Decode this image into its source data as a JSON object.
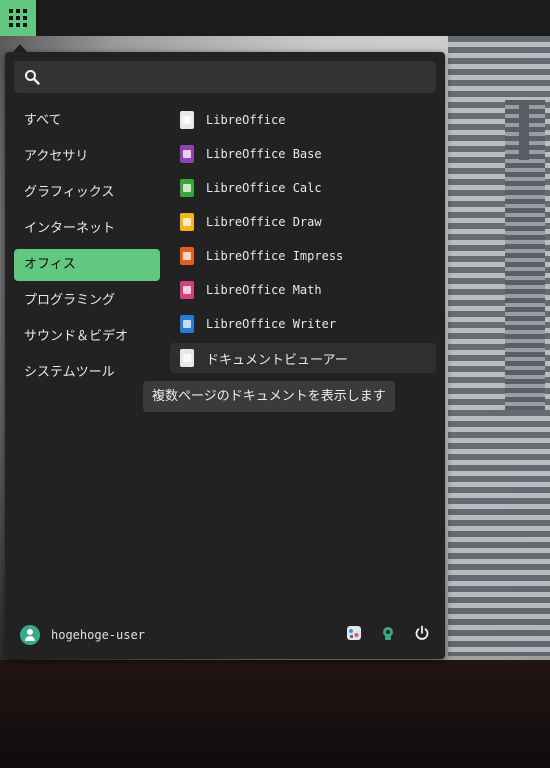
{
  "panel": {
    "app_grid_icon": "grid-icon"
  },
  "search": {
    "icon": "search-icon",
    "placeholder": "",
    "value": ""
  },
  "categories": [
    {
      "label": "すべて",
      "active": false
    },
    {
      "label": "アクセサリ",
      "active": false
    },
    {
      "label": "グラフィックス",
      "active": false
    },
    {
      "label": "インターネット",
      "active": false
    },
    {
      "label": "オフィス",
      "active": true
    },
    {
      "label": "プログラミング",
      "active": false
    },
    {
      "label": "サウンド＆ビデオ",
      "active": false
    },
    {
      "label": "システムツール",
      "active": false
    }
  ],
  "apps": [
    {
      "label": "LibreOffice",
      "icon": "libreoffice-icon",
      "color": "#e9e9e9"
    },
    {
      "label": "LibreOffice Base",
      "icon": "libreoffice-base-icon",
      "color": "#8e44ad"
    },
    {
      "label": "LibreOffice Calc",
      "icon": "libreoffice-calc-icon",
      "color": "#3ba53b"
    },
    {
      "label": "LibreOffice Draw",
      "icon": "libreoffice-draw-icon",
      "color": "#f2b41a"
    },
    {
      "label": "LibreOffice Impress",
      "icon": "libreoffice-impress-icon",
      "color": "#e2621d"
    },
    {
      "label": "LibreOffice Math",
      "icon": "libreoffice-math-icon",
      "color": "#d4407b"
    },
    {
      "label": "LibreOffice Writer",
      "icon": "libreoffice-writer-icon",
      "color": "#2a7ad8"
    },
    {
      "label": "ドキュメントビューアー",
      "icon": "document-viewer-icon",
      "color": "#e8e8e8"
    }
  ],
  "tooltip": {
    "text": "複数ページのドキュメントを表示します"
  },
  "user": {
    "name": "hogehoge-user",
    "avatar_icon": "user-avatar-icon"
  },
  "actions": [
    {
      "icon": "settings-icon"
    },
    {
      "icon": "lock-icon"
    },
    {
      "icon": "power-icon"
    }
  ],
  "colors": {
    "accent": "#62c880",
    "menu_bg": "#222222",
    "search_bg": "#333333"
  }
}
